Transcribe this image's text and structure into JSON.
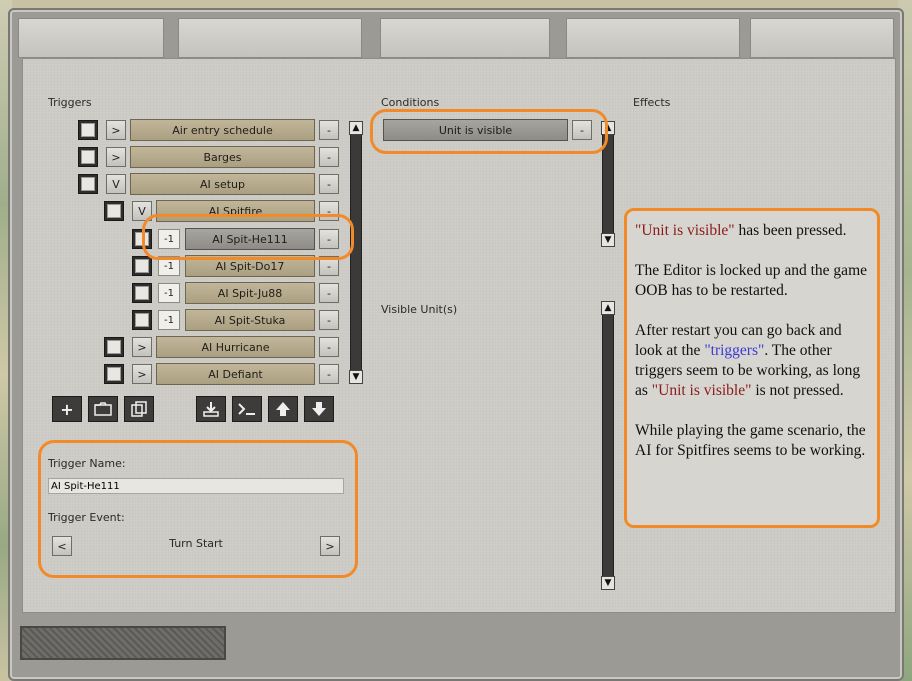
{
  "headers": {
    "triggers": "Triggers",
    "conditions": "Conditions",
    "effects": "Effects"
  },
  "triggers": [
    {
      "toggle": ">",
      "label": "Air entry schedule",
      "remove": "-"
    },
    {
      "toggle": ">",
      "label": "Barges",
      "remove": "-"
    },
    {
      "toggle": "V",
      "label": "AI setup",
      "remove": "-"
    },
    {
      "toggle": "V",
      "label": "AI Spitfire",
      "remove": "-"
    },
    {
      "value": "-1",
      "label": "AI Spit-He111",
      "remove": "-"
    },
    {
      "value": "-1",
      "label": "AI Spit-Do17",
      "remove": "-"
    },
    {
      "value": "-1",
      "label": "AI Spit-Ju88",
      "remove": "-"
    },
    {
      "value": "-1",
      "label": "AI Spit-Stuka",
      "remove": "-"
    },
    {
      "toggle": ">",
      "label": "AI Hurricane",
      "remove": "-"
    },
    {
      "toggle": ">",
      "label": "AI Defiant",
      "remove": "-"
    }
  ],
  "conditions": {
    "item": "Unit is visible",
    "remove": "-",
    "visible_units": "Visible Unit(s)"
  },
  "trigger_form": {
    "name_label": "Trigger Name:",
    "name_value": "AI Spit-He111",
    "event_label": "Trigger Event:",
    "event_value": "Turn Start",
    "prev": "<",
    "next": ">"
  },
  "annotation": {
    "p1_quote": "\"Unit is visible\"",
    "p1_rest": " has been pressed.",
    "p2": "The Editor is locked up and the game OOB has to be restarted.",
    "p3_a": "After restart you can go back and look at the ",
    "p3_link": "\"triggers\"",
    "p3_b": ". The other triggers seem to be working, as long as ",
    "p3_quote": "\"Unit is visible\"",
    "p3_c": " is not pressed.",
    "p4": "While playing the game scenario, the AI for Spitfires seems to be working."
  },
  "toolbar_icons": [
    "add-icon",
    "folder-icon",
    "copy-icon",
    "import-icon",
    "terminal-icon",
    "move-up-icon",
    "move-down-icon"
  ],
  "colors": {
    "highlight": "#f28a2a",
    "quote_red": "#8b1a1a",
    "link_blue": "#3a3ad4"
  }
}
